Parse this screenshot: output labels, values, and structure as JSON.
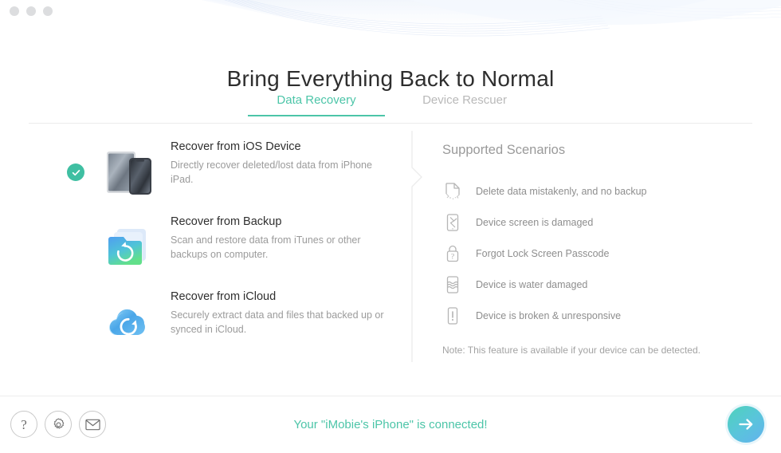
{
  "window": {
    "traffic_lights": [
      "close",
      "minimize",
      "zoom"
    ],
    "dot_color": "#dcdddf"
  },
  "header": {
    "title": "Bring Everything Back to Normal"
  },
  "tabs": [
    {
      "id": "data-recovery",
      "label": "Data Recovery",
      "active": true
    },
    {
      "id": "device-rescuer",
      "label": "Device Rescuer",
      "active": false
    }
  ],
  "recovery_modes": [
    {
      "id": "ios-device",
      "title": "Recover from iOS Device",
      "description": "Directly recover deleted/lost data from iPhone iPad.",
      "icon": "ipad-iphone-icon",
      "selected": true
    },
    {
      "id": "backup",
      "title": "Recover from Backup",
      "description": "Scan and restore data from iTunes or other backups on computer.",
      "icon": "backup-folder-icon",
      "selected": false
    },
    {
      "id": "icloud",
      "title": "Recover from iCloud",
      "description": "Securely extract data and files that backed up or synced in iCloud.",
      "icon": "icloud-restore-icon",
      "selected": false
    }
  ],
  "scenarios": {
    "heading": "Supported Scenarios",
    "items": [
      {
        "id": "deleted-no-backup",
        "label": "Delete data mistakenly, and no backup",
        "icon": "torn-document-icon"
      },
      {
        "id": "screen-damaged",
        "label": "Device screen is damaged",
        "icon": "cracked-screen-icon"
      },
      {
        "id": "forgot-passcode",
        "label": "Forgot Lock Screen Passcode",
        "icon": "lock-question-icon"
      },
      {
        "id": "water-damaged",
        "label": "Device is water damaged",
        "icon": "water-damage-icon"
      },
      {
        "id": "broken-unresponsive",
        "label": "Device is broken & unresponsive",
        "icon": "exclamation-device-icon"
      }
    ],
    "note": "Note: This feature is available if your device can be detected."
  },
  "bottom_bar": {
    "help_label": "?",
    "help_name": "help-icon",
    "settings_name": "gear-icon",
    "mail_name": "mail-icon",
    "status_text": "Your \"iMobie's iPhone\" is connected!",
    "next_name": "arrow-right-icon"
  },
  "colors": {
    "accent_teal": "#4cc5a8",
    "check_green": "#3fbfa2",
    "muted_text": "#9b9b9b",
    "title_text": "#2e2e2e",
    "next_gradient_start": "#4fd1bd",
    "next_gradient_end": "#5fb8ea"
  }
}
